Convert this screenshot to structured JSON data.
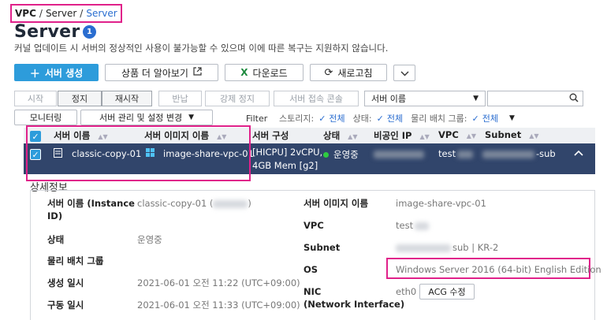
{
  "breadcrumb": {
    "vpc": "VPC",
    "sep": "/",
    "server": "Server",
    "current": "Server"
  },
  "page": {
    "title": "Server",
    "count": "1",
    "notice": "커널 업데이트 시 서버의 정상적인 사용이 불가능할 수 있으며 이에 따른 복구는 지원하지 않습니다."
  },
  "toolbar": {
    "create": "서버 생성",
    "learn_more": "상품 더 알아보기",
    "download": "다운로드",
    "refresh": "새로고침"
  },
  "actions": {
    "start": "시작",
    "stop": "정지",
    "restart": "재시작",
    "return": "반납",
    "force_stop": "강제 정지",
    "console": "서버 접속 콘솔",
    "search_select": "서버 이름",
    "search_placeholder": ""
  },
  "actions2": {
    "monitoring": "모니터링",
    "manage": "서버 관리 및 설정 변경"
  },
  "filter": {
    "label": "Filter",
    "storage_label": "스토리지:",
    "storage_value": "전체",
    "status_label": "상태:",
    "status_value": "전체",
    "placement_label": "물리 배치 그룹:",
    "placement_value": "전체"
  },
  "table": {
    "headers": {
      "name": "서버 이름",
      "image": "서버 이미지 이름",
      "spec": "서버 구성",
      "status": "상태",
      "private_ip": "비공인 IP",
      "vpc": "VPC",
      "subnet": "Subnet"
    },
    "row": {
      "name": "classic-copy-01",
      "image": "image-share-vpc-01",
      "spec_line1": "[HICPU] 2vCPU,",
      "spec_line2": "4GB Mem [g2]",
      "status": "운영중",
      "vpc": "test",
      "subnet_suffix": "-sub"
    }
  },
  "detail": {
    "title": "상세정보",
    "name_label_1": "서버 이름 (Instance",
    "name_label_2": "ID)",
    "name_value_prefix": "classic-copy-01 (",
    "name_value_suffix": ")",
    "image_label": "서버 이미지 이름",
    "image_value": "image-share-vpc-01",
    "status_label": "상태",
    "status_value": "운영중",
    "vpc_label": "VPC",
    "vpc_value": "test",
    "placement_label": "물리 배치 그룹",
    "subnet_label": "Subnet",
    "subnet_value_suffix": "sub | KR-2",
    "created_label": "생성 일시",
    "created_value": "2021-06-01 오전 11:22 (UTC+09:00)",
    "os_label": "OS",
    "os_value": "Windows Server 2016 (64-bit) English Edition",
    "uptime_label": "구동 일시",
    "uptime_value": "2021-06-01 오전 11:33 (UTC+09:00)",
    "nic_label_1": "NIC",
    "nic_label_2": "(Network Interface)",
    "nic_value": "eth0",
    "acg_button": "ACG 수정"
  },
  "colors": {
    "accent": "#2d9cdb",
    "link": "#2a6dd0",
    "selected_row": "#31456b",
    "highlight": "#e0218a",
    "status_ok": "#2ecc40"
  }
}
